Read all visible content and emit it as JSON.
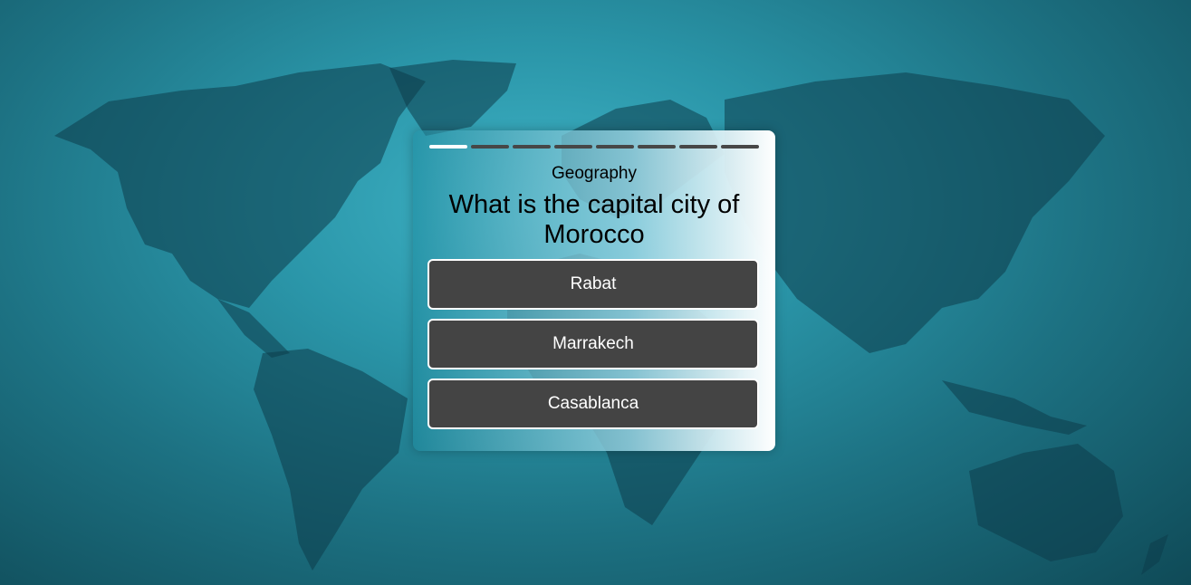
{
  "quiz": {
    "total_questions": 8,
    "current_question": 1,
    "category": "Geography",
    "question": "What is the capital city of Morocco",
    "answers": [
      {
        "label": "Rabat"
      },
      {
        "label": "Marrakech"
      },
      {
        "label": "Casablanca"
      }
    ]
  },
  "colors": {
    "progress_active": "#ffffff",
    "progress_inactive": "#474747",
    "answer_bg": "#444444",
    "answer_border": "#ffffff",
    "background": "#2a95a8"
  }
}
